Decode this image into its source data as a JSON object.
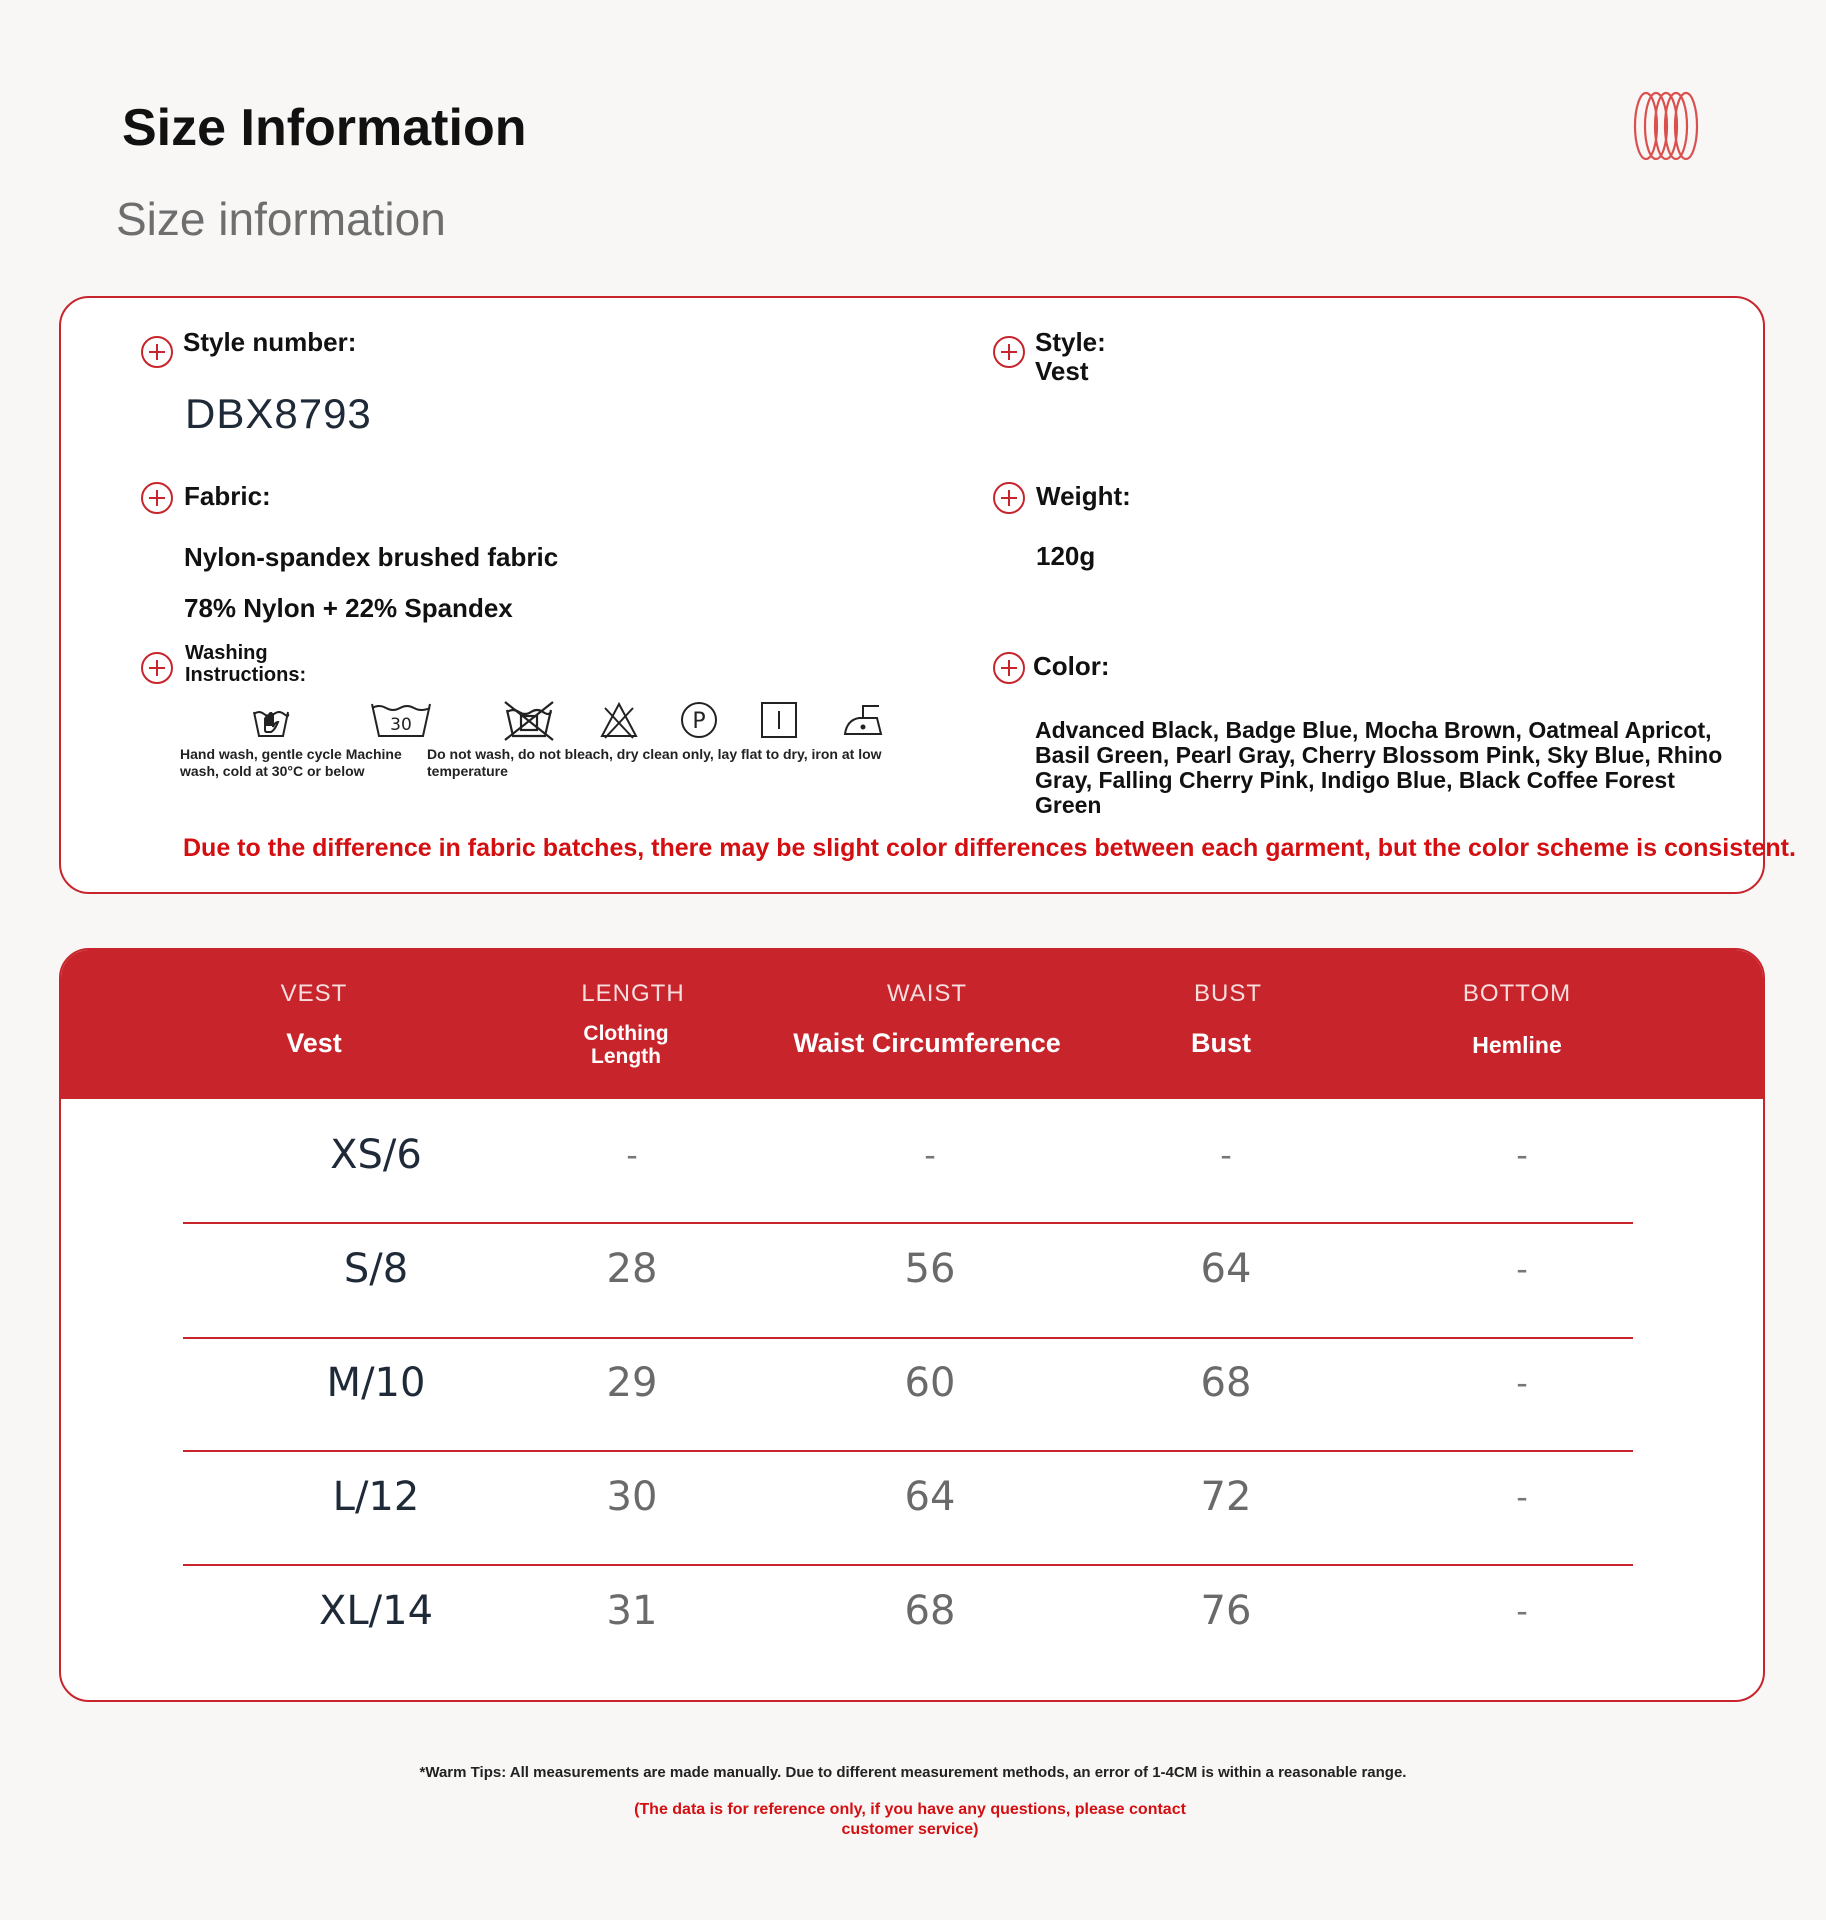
{
  "header": {
    "title": "Size Information",
    "subtitle": "Size information"
  },
  "info": {
    "style_number_label": "Style number:",
    "style_number_value": "DBX8793",
    "style_label": "Style:",
    "style_value": "Vest",
    "fabric_label": "Fabric:",
    "fabric_line1": "Nylon-spandex brushed fabric",
    "fabric_line2": "78% Nylon + 22% Spandex",
    "weight_label": "Weight:",
    "weight_value": "120g",
    "washing_label_line1": "Washing",
    "washing_label_line2": "Instructions:",
    "wash_temp": "30",
    "wash_note_left_line1": "Hand wash, gentle cycle Machine",
    "wash_note_left_line2": "wash, cold at 30°C or below",
    "wash_note_right_line1": "Do not wash, do not bleach, dry clean only, lay flat to dry, iron at low",
    "wash_note_right_line2": "temperature",
    "dry_clean_letter": "P",
    "color_label": "Color:",
    "color_value": "Advanced Black, Badge Blue, Mocha Brown, Oatmeal Apricot, Basil Green, Pearl Gray, Cherry Blossom Pink, Sky Blue, Rhino Gray, Falling Cherry Pink, Indigo Blue, Black Coffee Forest Green",
    "notice": "Due to the difference in fabric batches, there may be slight color differences between each garment, but the color scheme is consistent."
  },
  "table": {
    "columns": [
      {
        "en": "VEST",
        "label": "Vest",
        "label_lines": []
      },
      {
        "en": "LENGTH",
        "label": "",
        "label_lines": [
          "Clothing",
          "Length"
        ]
      },
      {
        "en": "WAIST",
        "label": "Waist Circumference",
        "label_lines": []
      },
      {
        "en": "BUST",
        "label": "Bust",
        "label_lines": []
      },
      {
        "en": "BOTTOM",
        "label": "Hemline",
        "label_lines": []
      }
    ],
    "rows": [
      [
        "XS/6",
        "-",
        "-",
        "-",
        "-"
      ],
      [
        "S/8",
        "28",
        "56",
        "64",
        "-"
      ],
      [
        "M/10",
        "29",
        "60",
        "68",
        "-"
      ],
      [
        "L/12",
        "30",
        "64",
        "72",
        "-"
      ],
      [
        "XL/14",
        "31",
        "68",
        "76",
        "-"
      ]
    ]
  },
  "footer": {
    "tips": "*Warm Tips: All measurements are made manually. Due to different measurement methods, an error of 1-4CM is within a reasonable range.",
    "ref_line1": "(The data is for reference only, if you have any questions, please contact",
    "ref_line2": "customer service)"
  },
  "colors": {
    "accent": "#c8242c",
    "notice_red": "#d40f12",
    "background": "#f8f7f6"
  },
  "icons": [
    "rings-logo-icon",
    "plus-circle-icon",
    "hand-wash-icon",
    "machine-wash-30-icon",
    "do-not-wash-icon",
    "do-not-bleach-icon",
    "dry-clean-p-icon",
    "lay-flat-dry-icon",
    "iron-low-icon"
  ]
}
